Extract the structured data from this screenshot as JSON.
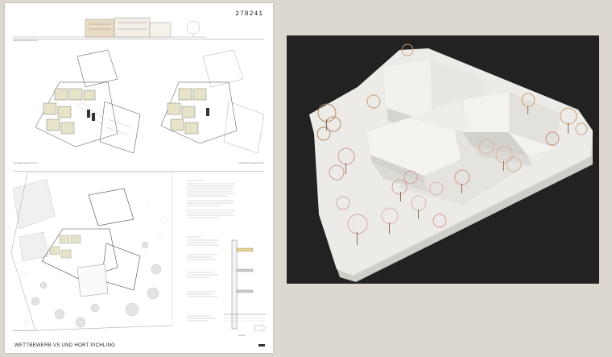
{
  "sheet": {
    "number": "278241",
    "title": "WETTBEWERB VS UND HORT PICHLING"
  },
  "labels": {
    "plan_upper_left": "GRUNDRISS ERDGESCHOSS",
    "plan_upper_right": "GRUNDRISS OBERGESCHOSS",
    "site_plan": "LAGEPLAN ERDGESCHOSS",
    "section": "SCHNITT",
    "text_block": "BAUBESCHREIBUNG"
  },
  "colors": {
    "background": "#ddd8cf",
    "sheet": "#ffffff",
    "photo_background": "#222222",
    "model": "#ecebe7",
    "accent_rooms": "#e6e3c8",
    "tree_pink": "#d9a3a0",
    "tree_tan": "#c9a27a"
  }
}
